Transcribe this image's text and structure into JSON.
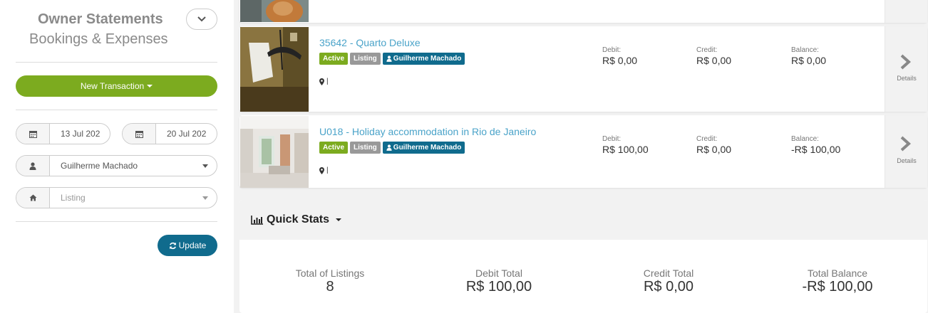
{
  "sidebar": {
    "title": "Owner Statements",
    "subtitle": "Bookings & Expenses",
    "new_transaction_label": "New Transaction",
    "date_from": "13 Jul 202",
    "date_to": "20 Jul 202",
    "owner_select": "Guilherme Machado",
    "listing_placeholder": "Listing",
    "update_label": "Update"
  },
  "listings": [
    {
      "title": "35642 - Quarto Deluxe",
      "status": "Active",
      "type": "Listing",
      "owner": "Guilherme Machado",
      "location": "|",
      "debit_label": "Debit:",
      "debit": "R$ 0,00",
      "credit_label": "Credit:",
      "credit": "R$ 0,00",
      "balance_label": "Balance:",
      "balance": "R$ 0,00",
      "details_label": "Details"
    },
    {
      "title": "U018 - Holiday accommodation in Rio de Janeiro",
      "status": "Active",
      "type": "Listing",
      "owner": "Guilherme Machado",
      "location": "|",
      "debit_label": "Debit:",
      "debit": "R$ 100,00",
      "credit_label": "Credit:",
      "credit": "R$ 0,00",
      "balance_label": "Balance:",
      "balance": "-R$ 100,00",
      "details_label": "Details"
    }
  ],
  "quick_stats": {
    "title": "Quick Stats",
    "items": [
      {
        "label": "Total of Listings",
        "value": "8"
      },
      {
        "label": "Debit Total",
        "value": "R$ 100,00"
      },
      {
        "label": "Credit Total",
        "value": "R$ 0,00"
      },
      {
        "label": "Total Balance",
        "value": "-R$ 100,00"
      }
    ]
  },
  "colors": {
    "accent_green": "#7cab1f",
    "accent_blue": "#106b8d",
    "link_blue": "#4aa3c9",
    "badge_gray": "#999999"
  },
  "icons": [
    "chevron-down-icon",
    "calendar-icon",
    "user-icon",
    "home-icon",
    "refresh-icon",
    "map-marker-icon",
    "chevron-right-icon",
    "bar-chart-icon"
  ]
}
